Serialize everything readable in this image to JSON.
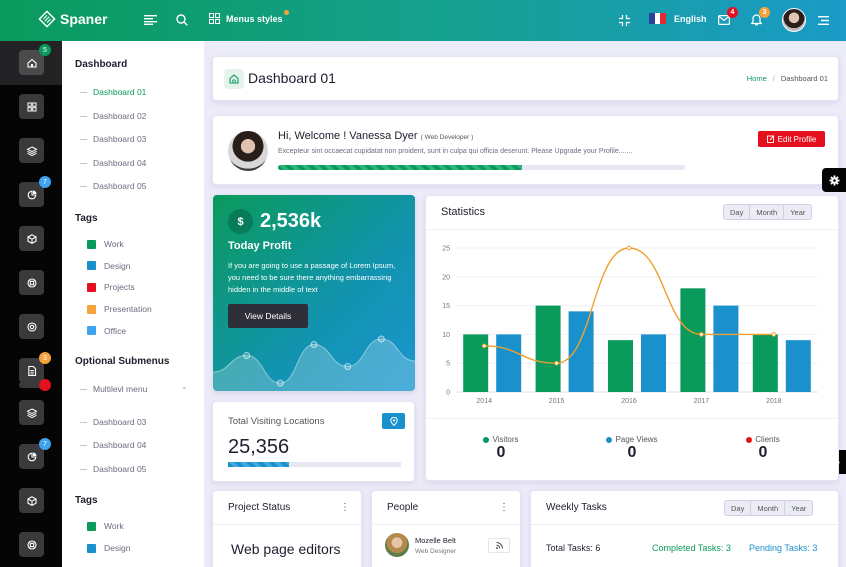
{
  "header": {
    "brand": "Spaner",
    "menus_styles_label": "Menus styles",
    "language": "English",
    "mail_badge": "4",
    "notification_badge": "3",
    "colors": {
      "mail_badge": "#e5101e",
      "notification_badge": "#f7a23a",
      "menus_dot": "#f7a23a"
    }
  },
  "rail": {
    "items": [
      {
        "icon": "home-icon",
        "badge": "5",
        "badge_color": "#0a9a5c",
        "active": true
      },
      {
        "icon": "grid-icon",
        "badge": null
      },
      {
        "icon": "layers-icon",
        "badge": null
      },
      {
        "icon": "pie-chart-icon",
        "badge": "7",
        "badge_color": "#3fa3f0"
      },
      {
        "icon": "box-icon",
        "badge": null
      },
      {
        "icon": "lifebuoy-icon",
        "badge": null
      },
      {
        "icon": "target-icon",
        "badge": null
      },
      {
        "icon": "file-icon",
        "badge": "3",
        "badge_color": "#f7a23a"
      },
      {
        "icon": "layers-icon",
        "badge": null
      },
      {
        "icon": "pie-chart-icon",
        "badge": "7",
        "badge_color": "#3fa3f0"
      },
      {
        "icon": "box-icon",
        "badge": null
      },
      {
        "icon": "lifebuoy-icon",
        "badge": null
      }
    ]
  },
  "submenu": {
    "dashboard_heading": "Dashboard",
    "dashboards": [
      "Dashboard 01",
      "Dashboard 02",
      "Dashboard 03",
      "Dashboard 04",
      "Dashboard 05"
    ],
    "tags_heading": "Tags",
    "tags": [
      {
        "label": "Work",
        "color": "#0a9a5c"
      },
      {
        "label": "Design",
        "color": "#1a90cc"
      },
      {
        "label": "Projects",
        "color": "#e5101e"
      },
      {
        "label": "Presentation",
        "color": "#f7a23a"
      },
      {
        "label": "Office",
        "color": "#3fa3f0"
      }
    ],
    "optional_heading": "Optional Submenus",
    "multilevel_label": "Multilevl menu",
    "more_dashboards": [
      "Dashboard 03",
      "Dashboard 04",
      "Dashboard 05"
    ],
    "tags2_heading": "Tags",
    "tags2": [
      {
        "label": "Work",
        "color": "#0a9a5c"
      },
      {
        "label": "Design",
        "color": "#1a90cc"
      }
    ]
  },
  "page": {
    "title": "Dashboard 01",
    "breadcrumb": {
      "home": "Home",
      "separator": "/",
      "current": "Dashboard 01"
    }
  },
  "welcome": {
    "greeting": "Hi, Welcome ! Vanessa Dyer",
    "role": "( Web Developer )",
    "text": "Excepteur sint occaecat cupidatat non proident, sunt in culpa qui officia deserunt. Please Upgrade your Profile.......",
    "progress_percent": 60,
    "edit_button": "Edit Profile"
  },
  "profit": {
    "currency_symbol": "$",
    "value": "2,536k",
    "label": "Today Profit",
    "text": "If you are going to use a passage of Lorem Ipsum, you need to be sure there anything embarrassing hidden in the middle of text",
    "button": "View Details",
    "sparkline": [
      3,
      6,
      1,
      8,
      4,
      9,
      5
    ]
  },
  "visits": {
    "title": "Total Visiting Locations",
    "value": "25,356",
    "progress_percent": 35
  },
  "statistics": {
    "title": "Statistics",
    "periods": [
      "Day",
      "Month",
      "Year"
    ],
    "legend": [
      {
        "label": "Visitors",
        "value": "0",
        "color": "#0a9a5c"
      },
      {
        "label": "Page Views",
        "value": "0",
        "color": "#1a90cc"
      },
      {
        "label": "Clients",
        "value": "0",
        "color": "#e5101e"
      }
    ]
  },
  "chart_data": {
    "type": "bar",
    "title": "Statistics",
    "categories": [
      "2014",
      "2015",
      "2016",
      "2017",
      "2018"
    ],
    "ylim": [
      0,
      25
    ],
    "yticks": [
      0,
      5,
      10,
      15,
      20,
      25
    ],
    "grid": true,
    "series": [
      {
        "name": "Visitors",
        "type": "bar",
        "color": "#0a9a5c",
        "values": [
          10,
          15,
          9,
          18,
          10
        ]
      },
      {
        "name": "Page Views",
        "type": "bar",
        "color": "#1a90cc",
        "values": [
          10,
          14,
          10,
          15,
          9
        ]
      },
      {
        "name": "Clients",
        "type": "line",
        "color": "#f0a030",
        "values": [
          8,
          5,
          25,
          10,
          10
        ]
      }
    ]
  },
  "project_status": {
    "title": "Project Status",
    "content": "Web page editors"
  },
  "people": {
    "title": "People",
    "person": {
      "name": "Mozelle Belt",
      "role": "Web Designer"
    }
  },
  "weekly_tasks": {
    "title": "Weekly Tasks",
    "periods": [
      "Day",
      "Month",
      "Year"
    ],
    "total": "Total Tasks: 6",
    "completed": "Completed Tasks: 3",
    "pending": "Pending Tasks: 3"
  }
}
